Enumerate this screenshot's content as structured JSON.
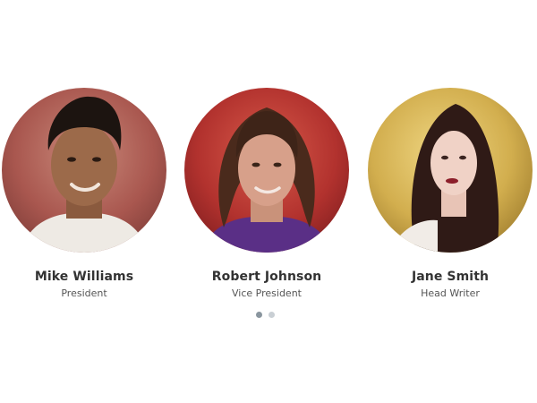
{
  "team": [
    {
      "name": "Mike Williams",
      "role": "President"
    },
    {
      "name": "Robert Johnson",
      "role": "Vice President"
    },
    {
      "name": "Jane Smith",
      "role": "Head Writer"
    }
  ],
  "pagination": {
    "active_index": 0,
    "count": 2
  },
  "colors": {
    "name_text": "#333333",
    "role_text": "#555555",
    "dot_active": "#8a969f",
    "dot_inactive": "#c9cfd4"
  }
}
